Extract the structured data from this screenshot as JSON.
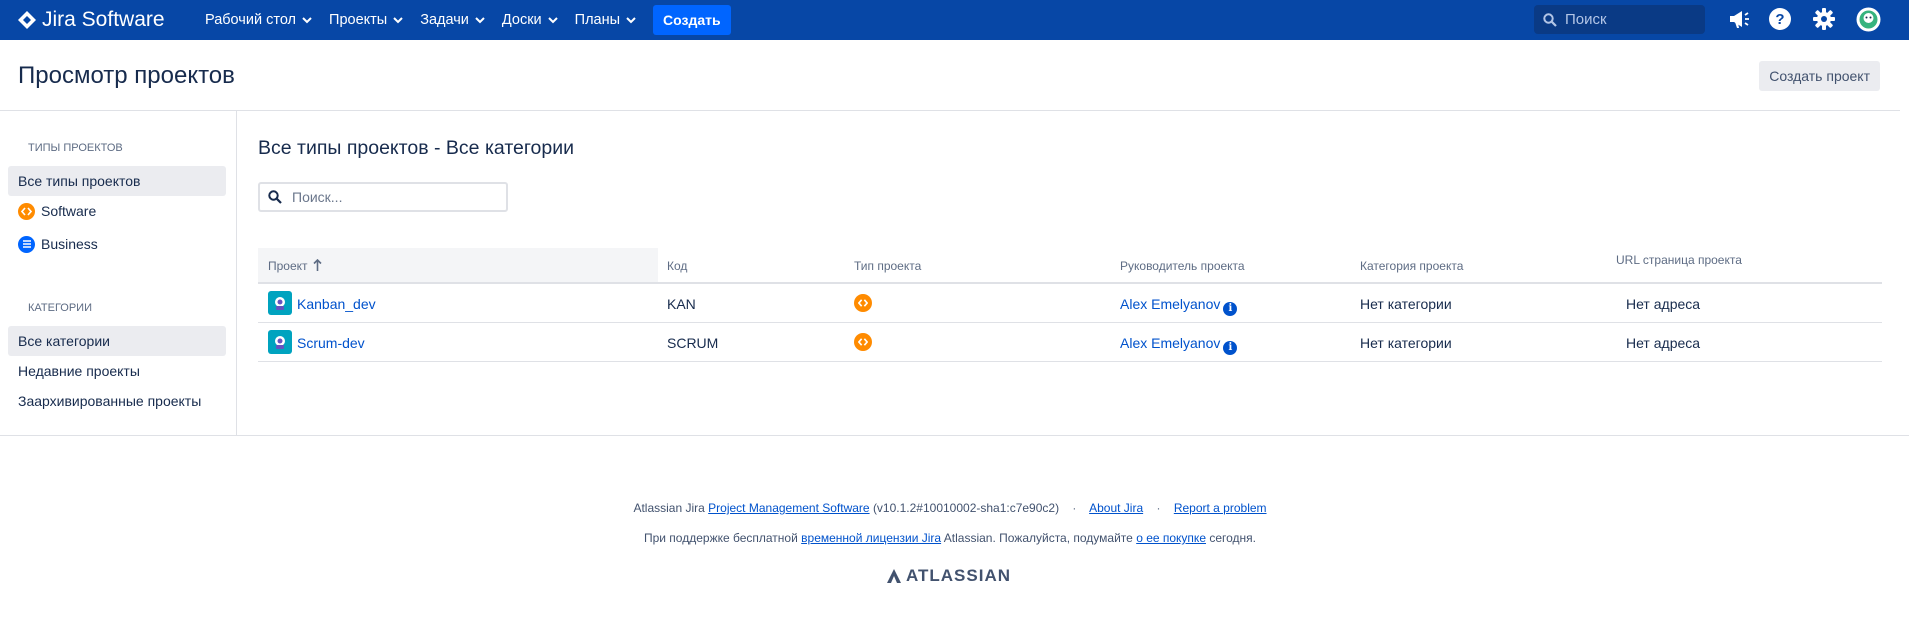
{
  "topbar": {
    "logo_text": "Jira Software",
    "nav": [
      {
        "label": "Рабочий стол"
      },
      {
        "label": "Проекты"
      },
      {
        "label": "Задачи"
      },
      {
        "label": "Доски"
      },
      {
        "label": "Планы"
      }
    ],
    "create_label": "Создать",
    "search_placeholder": "Поиск",
    "icons": [
      "megaphone-icon",
      "help-icon",
      "settings-icon",
      "profile-avatar-icon"
    ]
  },
  "header": {
    "title": "Просмотр проектов",
    "create_project_label": "Создать проект"
  },
  "sidebar": {
    "types_heading": "Типы проектов",
    "types": [
      {
        "label": "Все типы проектов",
        "active": true
      },
      {
        "label": "Software",
        "icon": "software-icon",
        "color": "#ff8b00"
      },
      {
        "label": "Business",
        "icon": "business-icon",
        "color": "#0065ff"
      }
    ],
    "categories_heading": "Категории",
    "categories": [
      {
        "label": "Все категории",
        "active": true
      },
      {
        "label": "Недавние проекты"
      },
      {
        "label": "Заархивированные проекты"
      }
    ]
  },
  "main": {
    "title": "Все типы проектов - Все категории",
    "filter_placeholder": "Поиск...",
    "columns": {
      "project": "Проект",
      "key": "Код",
      "type": "Тип проекта",
      "lead": "Руководитель проекта",
      "category": "Категория проекта",
      "url": "URL страница проекта"
    },
    "rows": [
      {
        "name": "Kanban_dev",
        "key": "KAN",
        "type_icon": "software-icon",
        "lead": "Alex Emelyanov",
        "category": "Нет категории",
        "url": "Нет адреса"
      },
      {
        "name": "Scrum-dev",
        "key": "SCRUM",
        "type_icon": "software-icon",
        "lead": "Alex Emelyanov",
        "category": "Нет категории",
        "url": "Нет адреса"
      }
    ]
  },
  "footer": {
    "line1_prefix": "Atlassian Jira",
    "line1_link": "Project Management Software",
    "line1_version": "(v10.1.2#10010002-sha1:c7e90c2)",
    "about_link": "About Jira",
    "report_link": "Report a problem",
    "line2_prefix": "При поддержке бесплатной",
    "line2_link": "временной лицензии Jira",
    "line2_middle": "Atlassian. Пожалуйста, подумайте",
    "line2_link2": "о ее покупке",
    "line2_suffix": "сегодня.",
    "brand": "ATLASSIAN"
  },
  "colors": {
    "topbar": "#0747a6",
    "create_button": "#0065ff",
    "link": "#0052cc",
    "software": "#ff8b00"
  }
}
